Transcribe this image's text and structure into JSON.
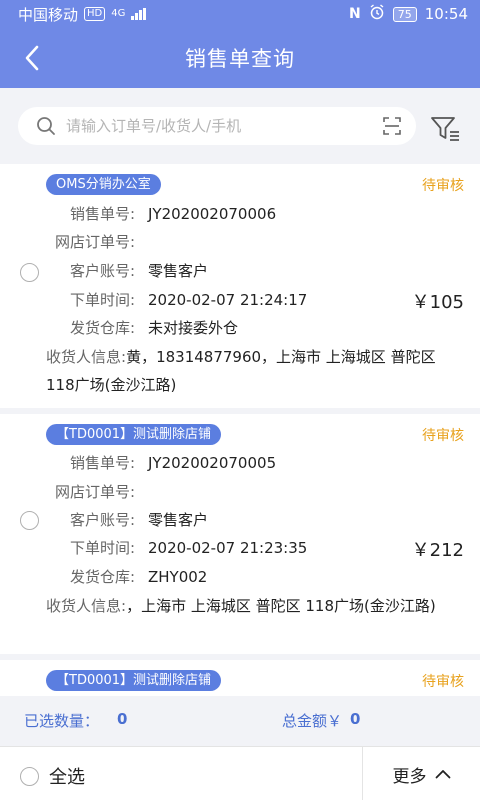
{
  "status_bar": {
    "carrier": "中国移动",
    "hd_badge": "HD",
    "network": "4G",
    "battery": "75",
    "time": "10:54"
  },
  "nav": {
    "title": "销售单查询"
  },
  "search": {
    "placeholder": "请输入订单号/收货人/手机",
    "value": ""
  },
  "labels": {
    "order_no": "销售单号:",
    "shop_order_no": "网店订单号:",
    "customer_account": "客户账号:",
    "order_time": "下单时间:",
    "warehouse": "发货仓库:",
    "receiver": "收货人信息:"
  },
  "orders": [
    {
      "store": "OMS分销办公室",
      "status": "待审核",
      "order_no": "JY202002070006",
      "shop_order_no": "",
      "customer_account": "零售客户",
      "order_time": "2020-02-07 21:24:17",
      "amount": "￥105",
      "warehouse": "未对接委外仓",
      "receiver": "黄，18314877960，上海市 上海城区 普陀区 118广场(金沙江路)"
    },
    {
      "store": "【TD0001】测试删除店铺",
      "status": "待审核",
      "order_no": "JY202002070005",
      "shop_order_no": "",
      "customer_account": "零售客户",
      "order_time": "2020-02-07 21:23:35",
      "amount": "￥212",
      "warehouse": "ZHY002",
      "receiver": "，上海市 上海城区 普陀区 118广场(金沙江路)"
    },
    {
      "store": "【TD0001】测试删除店铺",
      "status": "待审核"
    }
  ],
  "summary": {
    "selected_label": "已选数量：",
    "selected_count": "0",
    "total_label": "总金额￥",
    "total_value": "0"
  },
  "bottom": {
    "select_all": "全选",
    "more": "更多"
  },
  "colors": {
    "header": "#6f89e6",
    "store_tag": "#5b7ee0",
    "pending": "#e8a21e",
    "summary_text": "#4a6fd1"
  }
}
